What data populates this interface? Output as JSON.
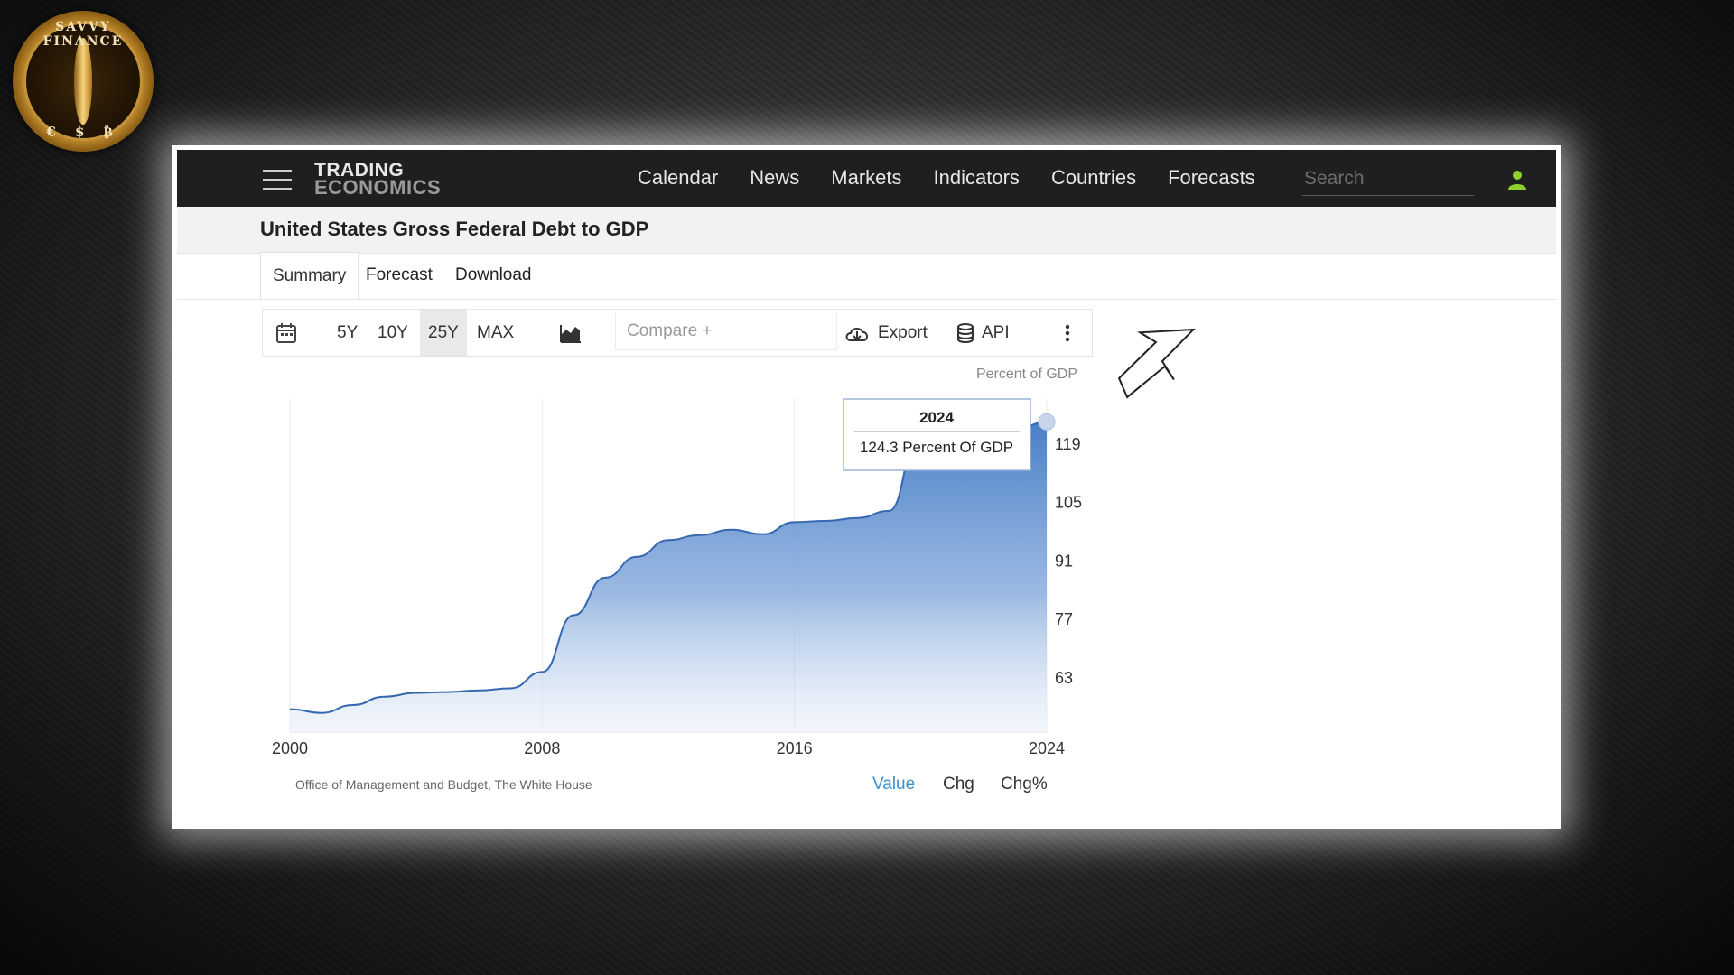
{
  "overlay": {
    "logo_text": "SAVVY FINANCE",
    "logo_symbols": "€ $ ₿",
    "colors": {
      "gold": "#c59338"
    }
  },
  "navbar": {
    "menu_icon": "hamburger-menu-icon",
    "brand_line1": "TRADING",
    "brand_line2": "ECONOMICS",
    "links": [
      "Calendar",
      "News",
      "Markets",
      "Indicators",
      "Countries",
      "Forecasts"
    ],
    "search_placeholder": "Search",
    "user_icon": "user-icon",
    "user_icon_color": "#8ed12e"
  },
  "page": {
    "title": "United States Gross Federal Debt to GDP",
    "tabs": [
      "Summary",
      "Forecast",
      "Download"
    ]
  },
  "toolbar": {
    "calendar_icon": "calendar-icon",
    "ranges": [
      "5Y",
      "10Y",
      "25Y",
      "MAX"
    ],
    "selected_range": "25Y",
    "chart_type_icon": "area-chart-icon",
    "compare_placeholder": "Compare +",
    "export_icon": "cloud-download-icon",
    "export_label": "Export",
    "api_icon": "database-icon",
    "api_label": "API",
    "more_icon": "more-vertical-icon"
  },
  "chart_data": {
    "type": "area",
    "ylabel": "Percent of GDP",
    "x": [
      2000,
      2001,
      2002,
      2003,
      2004,
      2005,
      2006,
      2007,
      2008,
      2009,
      2010,
      2011,
      2012,
      2013,
      2014,
      2015,
      2016,
      2017,
      2018,
      2019,
      2020,
      2021,
      2022,
      2023,
      2024
    ],
    "values": [
      55.5,
      54.6,
      56.5,
      58.5,
      59.4,
      59.6,
      60.0,
      60.5,
      64.4,
      78.0,
      87.0,
      92.0,
      96.0,
      97.2,
      98.5,
      97.4,
      100.3,
      100.6,
      101.3,
      103.0,
      122.9,
      123.2,
      121.0,
      122.5,
      124.3
    ],
    "xticks": [
      "2000",
      "2008",
      "2016",
      "2024"
    ],
    "yticks": [
      "63",
      "77",
      "91",
      "105",
      "119"
    ],
    "ylim": [
      50,
      130
    ],
    "area_color": "#4a80c8",
    "tooltip": {
      "year": "2024",
      "text": "124.3 Percent Of GDP"
    },
    "source": "Office of Management and Budget, The White House",
    "value_tabs": [
      "Value",
      "Chg",
      "Chg%"
    ],
    "active_value_tab": "Value",
    "active_tab_color": "#3a8fd0"
  }
}
